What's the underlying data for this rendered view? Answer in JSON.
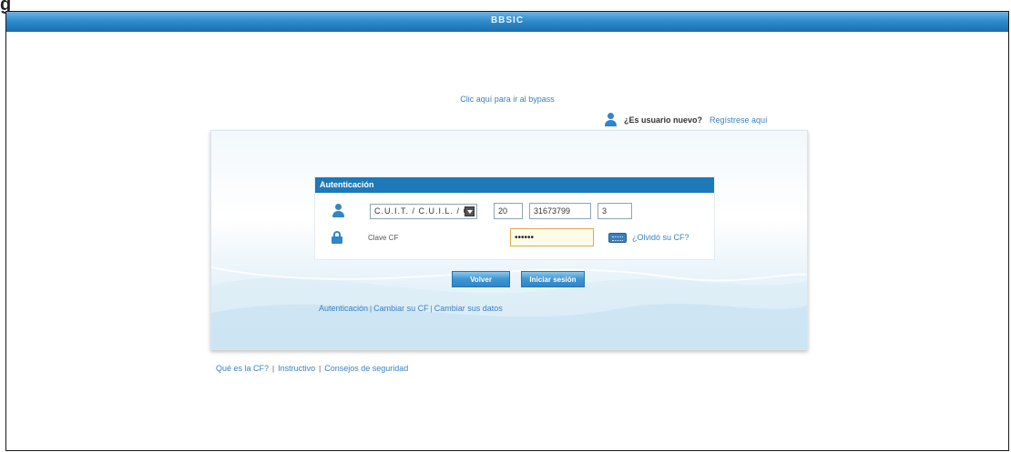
{
  "figure_label": "g",
  "topbar": {
    "title": "BBSIC"
  },
  "top_link": "Clic aquí para ir al bypass",
  "new_user": {
    "question": "¿Es usuario nuevo?",
    "register_link": "Regístrese aquí"
  },
  "auth": {
    "header": "Autenticación",
    "doc_type_selected": "C.U.I.T. / C.U.I.L. / C",
    "cuit_part1": "20",
    "cuit_part2": "31673799",
    "cuit_part3": "3",
    "clave_label": "Clave CF",
    "password_value": "••••••",
    "forgot_link": "¿Olvidó su CF?"
  },
  "buttons": {
    "volver": "Volver",
    "iniciar": "Iniciar sesión"
  },
  "panel_links": [
    "Autenticación",
    "Cambiar su CF",
    "Cambiar sus datos"
  ],
  "bottom_links": [
    "Qué es la CF?",
    "Instructivo",
    "Consejos de seguridad"
  ],
  "icons": {
    "user": "user-icon",
    "lock": "lock-icon",
    "keyboard": "virtual-keyboard-icon",
    "dropdown": "chevron-down-icon"
  },
  "colors": {
    "accent": "#1e79b8",
    "link": "#3a82c4",
    "topbar": "#2f8ccc"
  }
}
